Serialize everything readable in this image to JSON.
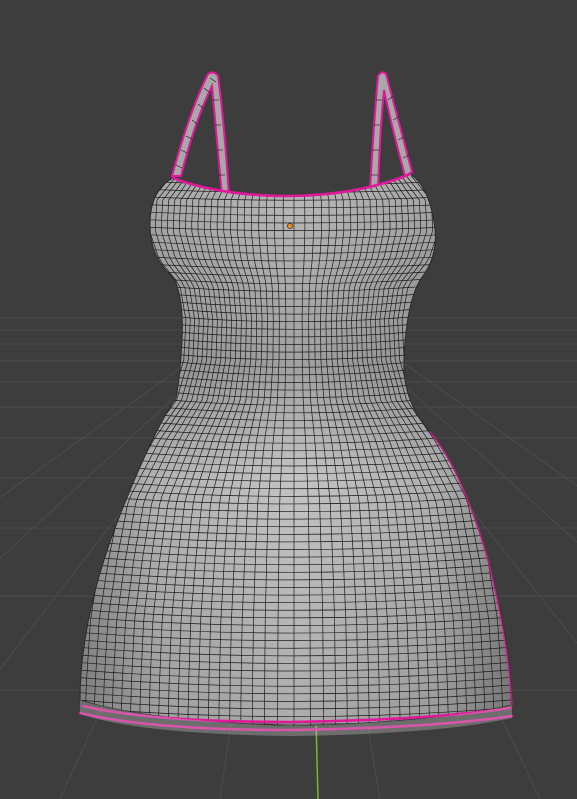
{
  "viewport": {
    "background_color": "#3d3d3d",
    "grid_line_color": "#4d4d4d",
    "axis_z_color": "#7fb32e"
  },
  "object": {
    "name": "dress",
    "mode": "edit",
    "shading": "solid-wireframe",
    "fill_color": "#b9b9b9",
    "wire_color": "#1a1a1a",
    "selected_edge_color": "#e0189a",
    "origin_color": "#f08a1e",
    "selected_loops": [
      "left-strap",
      "right-strap",
      "neckline",
      "hem-inner",
      "hem-outer"
    ]
  }
}
